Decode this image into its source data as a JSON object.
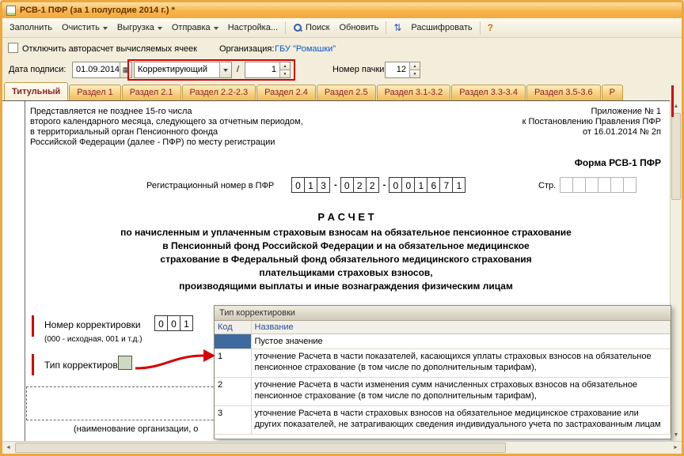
{
  "window": {
    "title": "РСВ-1 ПФР (за 1 полугодие 2014 г.) *"
  },
  "toolbar": {
    "fill": "Заполнить",
    "clear": "Очистить",
    "unload": "Выгрузка",
    "send": "Отправка",
    "settings": "Настройка...",
    "search": "Поиск",
    "refresh": "Обновить",
    "decipher": "Расшифровать",
    "help": "?"
  },
  "options": {
    "autocalc_label": "Отключить авторасчет вычисляемых ячеек",
    "org_label": "Организация:",
    "org_value": "ГБУ \"Ромашки\""
  },
  "signdate": {
    "label": "Дата подписи:",
    "value": "01.09.2014",
    "correction_type": "Корректирующий",
    "slash": "/",
    "correction_number": "1",
    "pack_label": "Номер пачки:",
    "pack_number": "12"
  },
  "tabs": {
    "items": [
      {
        "label": "Титульный"
      },
      {
        "label": "Раздел 1"
      },
      {
        "label": "Раздел 2.1"
      },
      {
        "label": "Раздел 2.2-2.3"
      },
      {
        "label": "Раздел 2.4"
      },
      {
        "label": "Раздел 2.5"
      },
      {
        "label": "Раздел 3.1-3.2"
      },
      {
        "label": "Раздел 3.3-3.4"
      },
      {
        "label": "Раздел 3.5-3.6"
      },
      {
        "label": "Р"
      }
    ]
  },
  "form": {
    "submit_note": [
      "Представляется не позднее 15-го числа",
      "второго календарного месяца, следующего за отчетным периодом,",
      "в территориальный орган Пенсионного фонда",
      "Российской Федерации (далее - ПФР) по месту регистрации"
    ],
    "appendix_note": [
      "Приложение № 1",
      "к Постановлению Правления ПФР",
      "от 16.01.2014 № 2п"
    ],
    "form_name": "Форма РСВ-1 ПФР",
    "reg_number_label": "Регистрационный номер в ПФР",
    "reg_digits": [
      "0",
      "1",
      "3",
      "0",
      "2",
      "2",
      "0",
      "0",
      "1",
      "6",
      "7",
      "1"
    ],
    "dash": "-",
    "page_label": "Стр.",
    "calc_title": "Р А С Ч Е Т",
    "calc_subtitle": [
      "по начисленным и уплаченным страховым взносам на обязательное пенсионное страхование",
      "в Пенсионный фонд Российской Федерации и на обязательное медицинское",
      "страхование в Федеральный фонд обязательного медицинского страхования",
      "плательщиками страховых взносов,",
      "производящими выплаты и иные вознаграждения физическим лицам"
    ],
    "correction_number_label": "Номер корректировки",
    "correction_number_digits": [
      "0",
      "0",
      "1"
    ],
    "correction_number_hint": "(000 - исходная, 001 и т.д.)",
    "correction_type_label": "Тип корректировки",
    "org_name_caption": "(наименование организации, о"
  },
  "popup": {
    "title": "Тип корректировки",
    "columns": {
      "code": "Код",
      "name": "Название"
    },
    "rows": [
      {
        "code": "",
        "name": "Пустое значение"
      },
      {
        "code": "1",
        "name": "уточнение Расчета в части показателей, касающихся уплаты страховых взносов на обязательное пенсионное страхование (в том числе по дополнительным тарифам),"
      },
      {
        "code": "2",
        "name": "уточнение Расчета в части изменения сумм начисленных страховых взносов на обязательное пенсионное страхование (в том числе по дополнительным тарифам),"
      },
      {
        "code": "3",
        "name": "уточнение Расчета в части страховых взносов на обязательное медицинское страхование или других показателей, не затрагивающих сведения индивидуального учета по застрахованным лицам"
      }
    ]
  },
  "icons": {
    "calendar": "▦",
    "spin_up": "▲",
    "spin_down": "▼",
    "scroll_up": "▲",
    "scroll_down": "▼",
    "scroll_left": "◄",
    "scroll_right": "►",
    "updown_arrows": "⇅"
  },
  "colors": {
    "annotation_red": "#d40000",
    "link_blue": "#0a58c8",
    "selection_blue": "#3f6a9e",
    "window_border": "#eca73e"
  }
}
